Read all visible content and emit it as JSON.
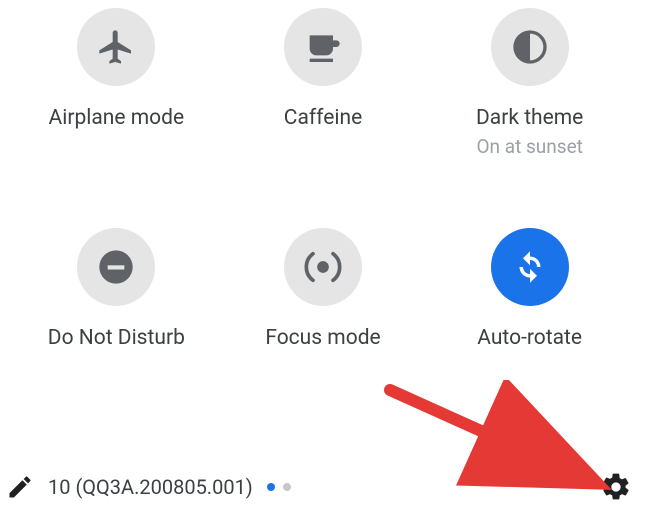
{
  "tiles": [
    {
      "label": "Airplane mode",
      "sub": "",
      "icon": "airplane",
      "active": false
    },
    {
      "label": "Caffeine",
      "sub": "",
      "icon": "caffeine",
      "active": false
    },
    {
      "label": "Dark theme",
      "sub": "On at sunset",
      "icon": "dark",
      "active": false
    },
    {
      "label": "Do Not Disturb",
      "sub": "",
      "icon": "dnd",
      "active": false
    },
    {
      "label": "Focus mode",
      "sub": "",
      "icon": "focus",
      "active": false
    },
    {
      "label": "Auto-rotate",
      "sub": "",
      "icon": "autorotate",
      "active": true
    }
  ],
  "footer": {
    "build": "10 (QQ3A.200805.001)"
  },
  "pager": {
    "current": 0,
    "total": 2
  },
  "colors": {
    "accent": "#1a73e8",
    "icon_gray": "#5f6368",
    "arrow": "#e53935"
  }
}
